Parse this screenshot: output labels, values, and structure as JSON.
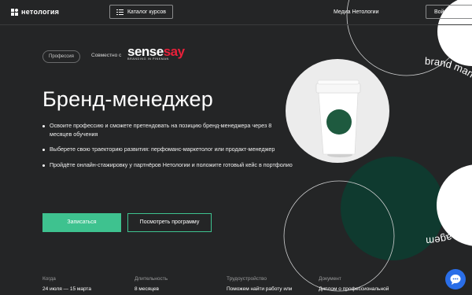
{
  "header": {
    "logo_text": "нетология",
    "catalog_label": "Каталог курсов",
    "media_label": "Медиа Нетологии",
    "login_label": "Войти"
  },
  "hero": {
    "chip": "Профессия",
    "collab": "Совместно с",
    "partner": {
      "sense": "sense",
      "say": "say",
      "sub": "BRANDING IN PINKMAN"
    },
    "title": "Бренд-менеджер",
    "bullets": [
      "Освоите профессию и сможете претендовать на позицию бренд-менеджера через 8 месяцев обучения",
      "Выберете свою траекторию развития: перфоманс-маркетолог или продакт-менеджер",
      "Пройдёте онлайн-стажировку у партнёров Нетологии и положите готовый кейс в портфолио"
    ],
    "enroll_label": "Записаться",
    "program_label": "Посмотреть программу"
  },
  "art": {
    "arc_text": "brand management • brand management • brand management",
    "accent": "#0f3a2f",
    "badge_color": "#1e5a3f"
  },
  "facts": [
    {
      "label": "Когда",
      "value": "24 июля — 15 марта"
    },
    {
      "label": "Длительность",
      "value": "8 месяцев"
    },
    {
      "label": "Трудоустройство",
      "value": "Поможем найти работу или"
    },
    {
      "label": "Документ",
      "value": "Диплом о профессиональной"
    }
  ],
  "colors": {
    "bg": "#242526",
    "green": "#3ec28f",
    "chat": "#2a6ee8"
  },
  "icons": {
    "catalog": "menu-list-icon",
    "chat": "chat-bubble-icon"
  }
}
